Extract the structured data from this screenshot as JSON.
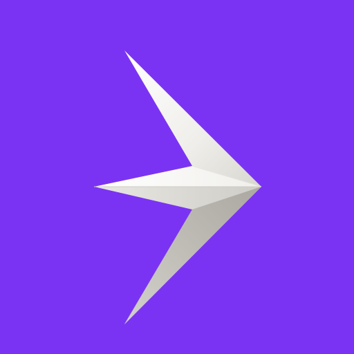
{
  "app_icon": {
    "background_color": "#7B33F3",
    "logo_icon": "arrow-chevron-logo-icon",
    "logo_colors": {
      "highlight": "#FFFFFF",
      "light": "#F3F2EF",
      "mid": "#D9D7D2",
      "shadow": "#B4B1AA"
    }
  }
}
